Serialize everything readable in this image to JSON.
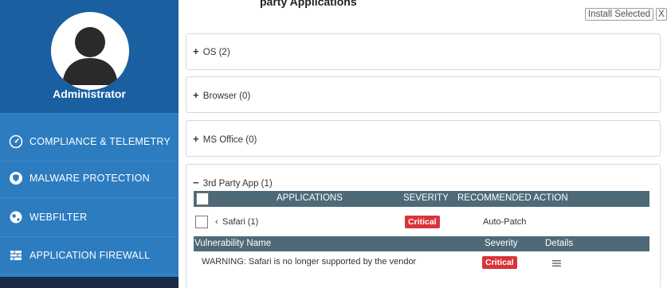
{
  "top": {
    "partial_title": "party Applications",
    "install_label": "Install Selected",
    "close_label": "X"
  },
  "sidebar": {
    "user": "Administrator",
    "items": [
      {
        "label": "COMPLIANCE & TELEMETRY",
        "icon": "gauge-icon"
      },
      {
        "label": "MALWARE PROTECTION",
        "icon": "shield-icon"
      },
      {
        "label": "WEBFILTER",
        "icon": "globe-icon"
      },
      {
        "label": "APPLICATION FIREWALL",
        "icon": "firewall-icon"
      }
    ]
  },
  "groups": [
    {
      "label": "OS (2)",
      "symbol": "+"
    },
    {
      "label": "Browser (0)",
      "symbol": "+"
    },
    {
      "label": "MS Office (0)",
      "symbol": "+"
    },
    {
      "label": "3rd Party App (1)",
      "symbol": "−"
    }
  ],
  "apps_table": {
    "headers": {
      "applications": "APPLICATIONS",
      "severity": "SEVERITY",
      "action": "RECOMMENDED ACTION"
    },
    "row": {
      "name": "Safari (1)",
      "severity": "Critical",
      "action": "Auto-Patch"
    }
  },
  "vuln_table": {
    "headers": {
      "name": "Vulnerability Name",
      "severity": "Severity",
      "details": "Details"
    },
    "row": {
      "name": "WARNING: Safari is no longer supported by the vendor",
      "severity": "Critical",
      "details_icon": "menu-icon"
    }
  },
  "colors": {
    "sidebar": "#2d7cc0",
    "profile": "#1a5f9f",
    "table_header": "#4e6a78",
    "critical": "#d9343a"
  }
}
